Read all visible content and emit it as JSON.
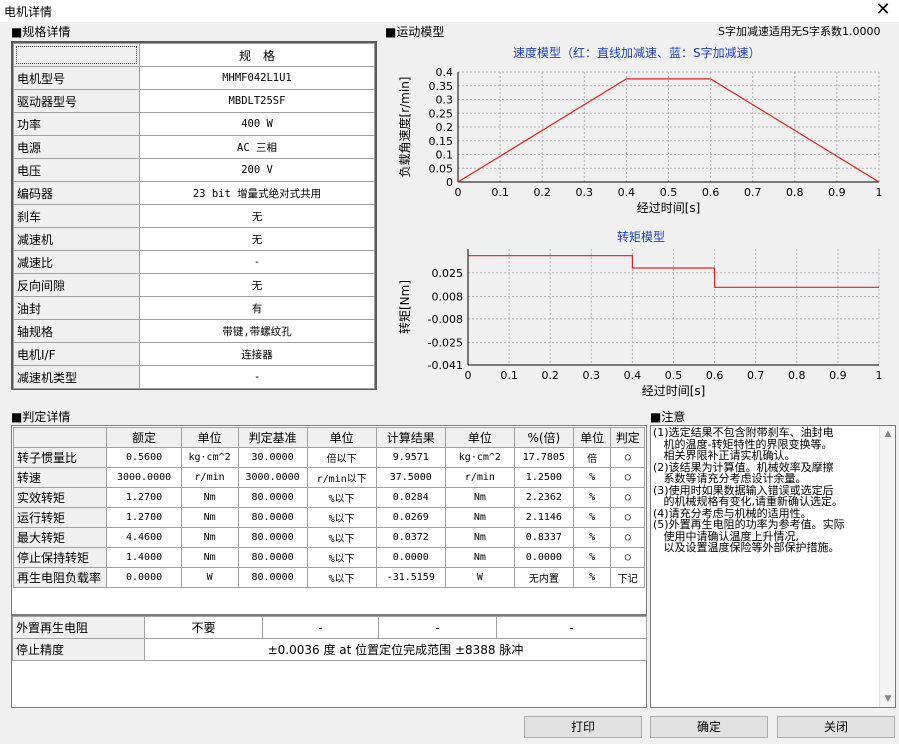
{
  "window": {
    "title": "电机详情",
    "close_glyph": "✕"
  },
  "spec_section": {
    "label": "■规格详情",
    "header": "规格",
    "rows": [
      {
        "label": "电机型号",
        "value": "MHMF042L1U1"
      },
      {
        "label": "驱动器型号",
        "value": "MBDLT25SF"
      },
      {
        "label": "功率",
        "value": "400 W"
      },
      {
        "label": "电源",
        "value": "AC 三相"
      },
      {
        "label": "电压",
        "value": "200 V"
      },
      {
        "label": "编码器",
        "value": "23 bit 增量式绝对式共用"
      },
      {
        "label": "刹车",
        "value": "无"
      },
      {
        "label": "减速机",
        "value": "无"
      },
      {
        "label": "减速比",
        "value": "-"
      },
      {
        "label": "反向间隙",
        "value": "无"
      },
      {
        "label": "油封",
        "value": "有"
      },
      {
        "label": "轴规格",
        "value": "带键,带螺纹孔"
      },
      {
        "label": "电机I/F",
        "value": "连接器"
      },
      {
        "label": "减速机类型",
        "value": "-"
      }
    ]
  },
  "motion_section": {
    "label": "■运动模型",
    "s_curve_note": "S字加减速适用无S字系数1.0000"
  },
  "chart_data": [
    {
      "type": "line",
      "title": "速度模型（红：直线加减速、蓝：S字加减速）",
      "xlabel": "经过时间[s]",
      "ylabel": "负载角速度[r/min]",
      "xlim": [
        0,
        1
      ],
      "ylim": [
        0,
        0.4
      ],
      "xticks": [
        "0",
        "0.1",
        "0.2",
        "0.3",
        "0.4",
        "0.5",
        "0.6",
        "0.7",
        "0.8",
        "0.9",
        "1"
      ],
      "yticks": [
        "0",
        "0.05",
        "0.1",
        "0.15",
        "0.2",
        "0.25",
        "0.3",
        "0.35",
        "0.4"
      ],
      "grid": true,
      "series": [
        {
          "color": "#e02020",
          "x": [
            0,
            0.4,
            0.6,
            1.0
          ],
          "y": [
            0,
            0.375,
            0.375,
            0
          ]
        }
      ]
    },
    {
      "type": "line",
      "title": "转矩模型",
      "xlabel": "经过时间[s]",
      "ylabel": "转矩[Nm]",
      "xlim": [
        0,
        1
      ],
      "ylim": [
        -0.041,
        0.042
      ],
      "xticks": [
        "0",
        "0.1",
        "0.2",
        "0.3",
        "0.4",
        "0.5",
        "0.6",
        "0.7",
        "0.8",
        "0.9",
        "1"
      ],
      "yticks": [
        "0.025",
        "0.008",
        "-0.008",
        "-0.025",
        "-0.041"
      ],
      "ytick_values": [
        0.025,
        0.008,
        -0.008,
        -0.025,
        -0.041
      ],
      "grid": true,
      "series": [
        {
          "color": "#e02020",
          "x": [
            0,
            0.4,
            0.4,
            0.6,
            0.6,
            1.0
          ],
          "y": [
            0.0372,
            0.0372,
            0.0284,
            0.0284,
            0.0146,
            0.0146
          ]
        }
      ]
    }
  ],
  "judge_section": {
    "label": "■判定详情",
    "headers": [
      "",
      "额定",
      "单位",
      "判定基准",
      "单位",
      "计算结果",
      "单位",
      "%(倍)",
      "单位",
      "判定"
    ],
    "rows": [
      [
        "转子惯量比",
        "0.5600",
        "kg·cm^2",
        "30.0000",
        "倍以下",
        "9.9571",
        "kg·cm^2",
        "17.7805",
        "倍",
        "○"
      ],
      [
        "转速",
        "3000.0000",
        "r/min",
        "3000.0000",
        "r/min以下",
        "37.5000",
        "r/min",
        "1.2500",
        "%",
        "○"
      ],
      [
        "实效转矩",
        "1.2700",
        "Nm",
        "80.0000",
        "%以下",
        "0.0284",
        "Nm",
        "2.2362",
        "%",
        "○"
      ],
      [
        "运行转矩",
        "1.2700",
        "Nm",
        "80.0000",
        "%以下",
        "0.0269",
        "Nm",
        "2.1146",
        "%",
        "○"
      ],
      [
        "最大转矩",
        "4.4600",
        "Nm",
        "80.0000",
        "%以下",
        "0.0372",
        "Nm",
        "0.8337",
        "%",
        "○"
      ],
      [
        "停止保持转矩",
        "1.4000",
        "Nm",
        "80.0000",
        "%以下",
        "0.0000",
        "Nm",
        "0.0000",
        "%",
        "○"
      ],
      [
        "再生电阻负载率",
        "0.0000",
        "W",
        "80.0000",
        "%以下",
        "-31.5159",
        "W",
        "无内置",
        "%",
        "下记"
      ]
    ],
    "regen_label": "外置再生电阻",
    "regen_values": [
      "不要",
      "-",
      "-",
      "-"
    ],
    "stop_label": "停止精度",
    "stop_value": "±0.0036 度  at  位置定位完成范围 ±8388 脉冲"
  },
  "notes_section": {
    "label": "■注意",
    "lines": [
      "(1)选定结果不包含附带刹车、油封电",
      "   机的温度-转矩特性的界限变换等。",
      "   相关界限补正请实机确认。",
      "(2)该结果为计算值。机械效率及摩擦",
      "   系数等请充分考虑设计余量。",
      "(3)使用时如果数据输入错误或选定后",
      "   的机械规格有变化,请重新确认选定。",
      "(4)请充分考虑与机械的适用性。",
      "(5)外置再生电阻的功率为参考值。实际",
      "   使用中请确认温度上升情况,",
      "   以及设置温度保险等外部保护措施。"
    ]
  },
  "buttons": {
    "print": "打印",
    "ok": "确定",
    "close": "关闭"
  }
}
